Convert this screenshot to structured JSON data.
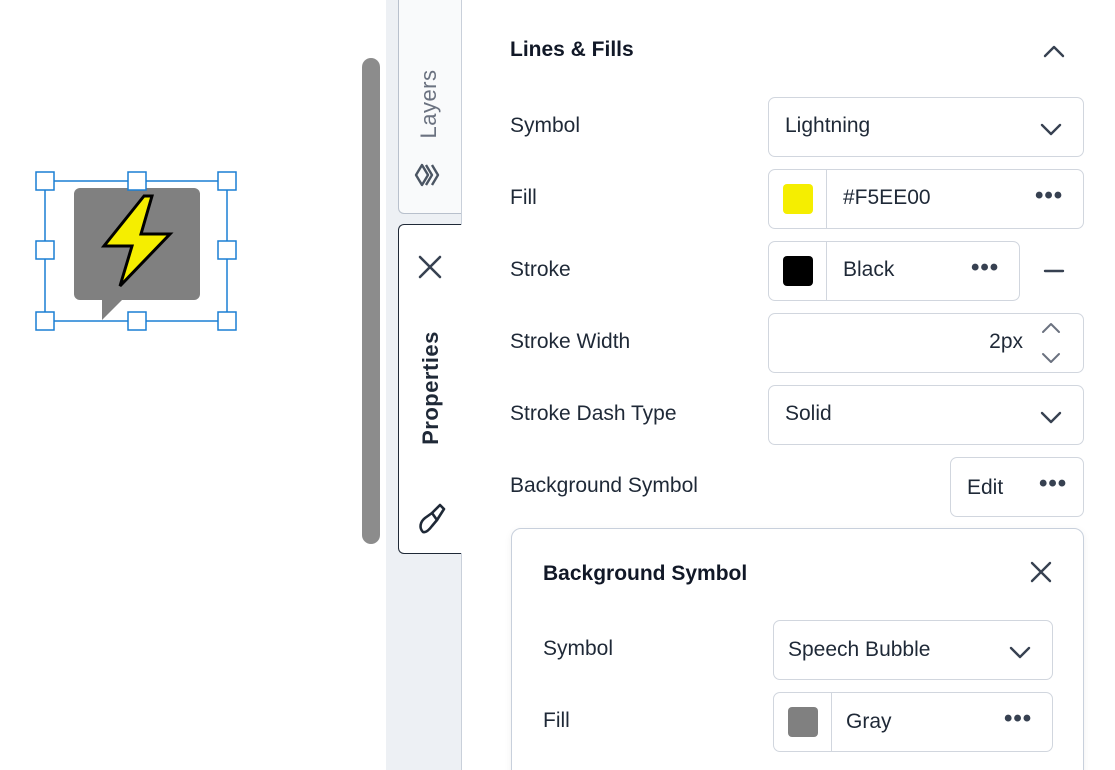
{
  "tabs": {
    "layers_label": "Layers",
    "properties_label": "Properties"
  },
  "section": {
    "title": "Lines & Fills"
  },
  "fields": {
    "symbol": {
      "label": "Symbol",
      "value": "Lightning"
    },
    "fill": {
      "label": "Fill",
      "value": "#F5EE00",
      "swatch_color": "#F5EE00"
    },
    "stroke": {
      "label": "Stroke",
      "value": "Black",
      "swatch_color": "#000000"
    },
    "stroke_width": {
      "label": "Stroke Width",
      "value": "2px"
    },
    "stroke_dash": {
      "label": "Stroke Dash Type",
      "value": "Solid"
    },
    "background_symbol": {
      "label": "Background Symbol",
      "edit_label": "Edit"
    }
  },
  "subpanel": {
    "title": "Background Symbol",
    "symbol": {
      "label": "Symbol",
      "value": "Speech Bubble"
    },
    "fill": {
      "label": "Fill",
      "value": "Gray",
      "swatch_color": "#808080"
    }
  },
  "icons": {
    "canvas_symbol": "lightning-icon",
    "canvas_background": "speech-bubble-icon",
    "layers_tab": "layers-icon",
    "properties_tab": "paint-brush-icon"
  },
  "colors": {
    "accent": "#1a7fd4",
    "selection": "#1a7fd4",
    "lightning_fill": "#F5EE00",
    "bubble_fill": "#808080"
  }
}
